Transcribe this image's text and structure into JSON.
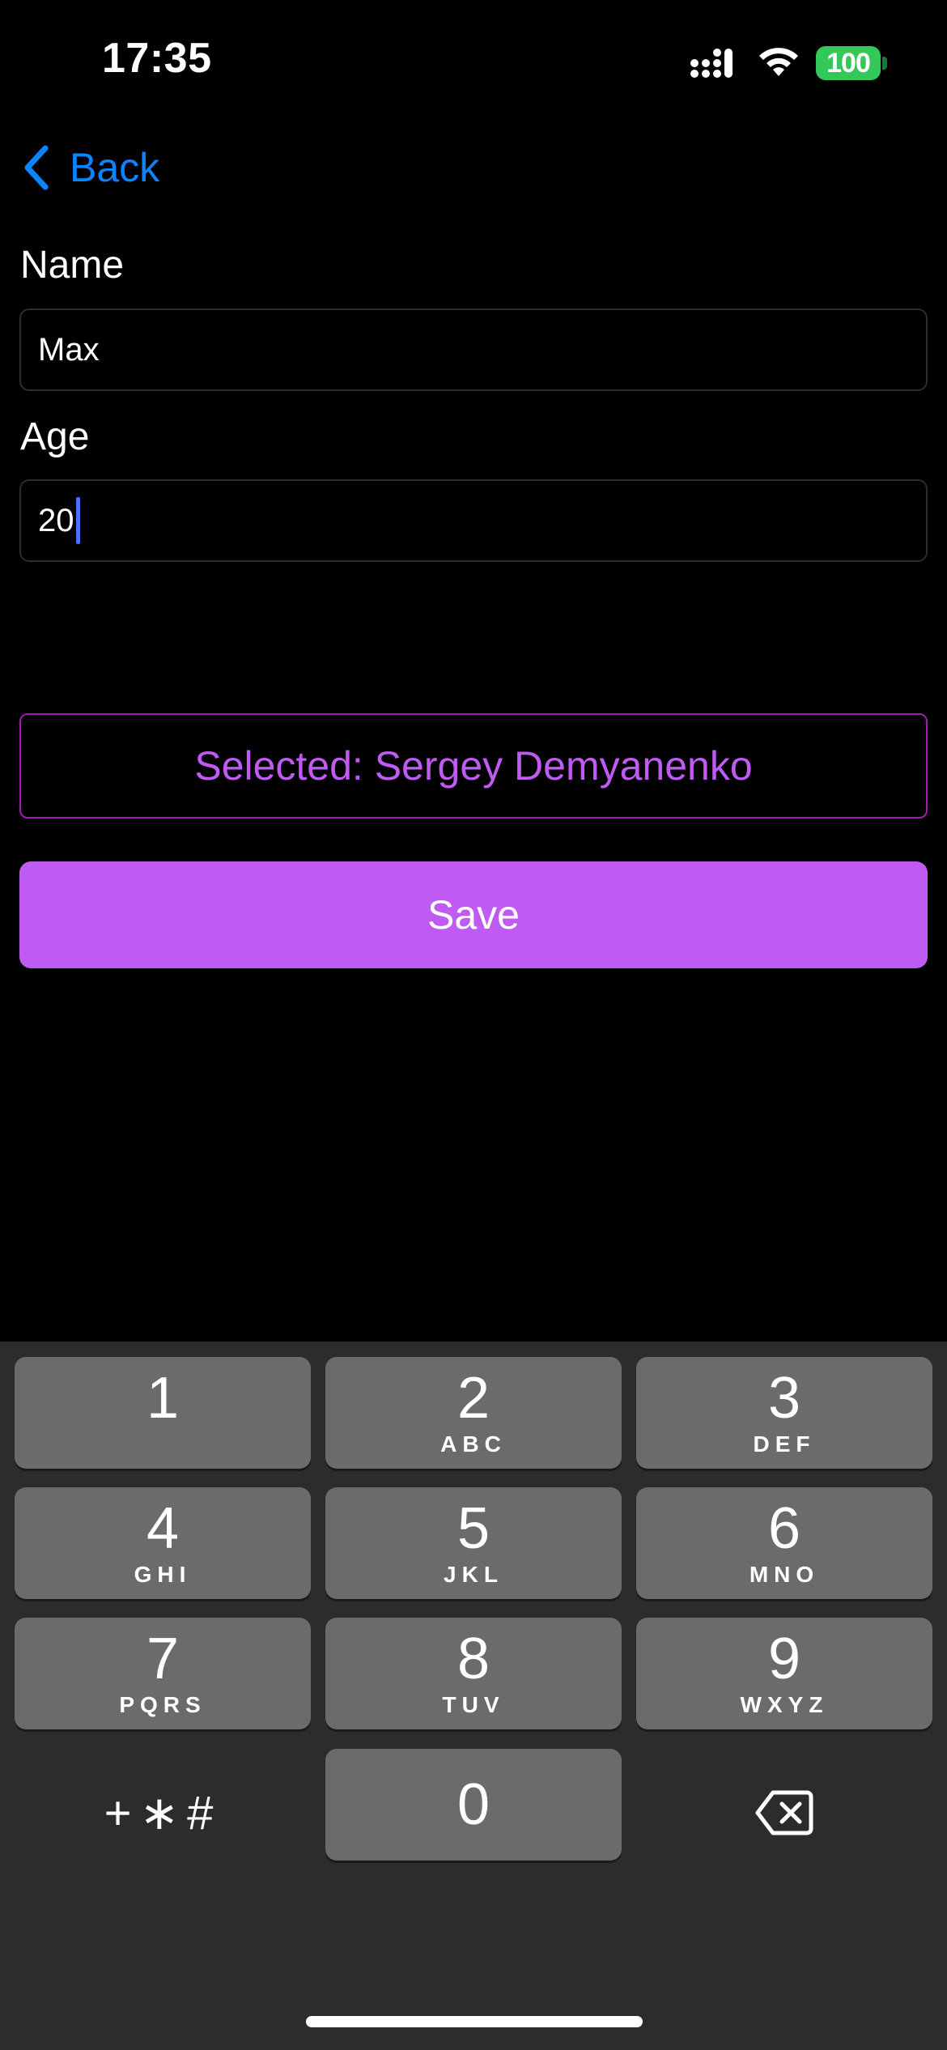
{
  "status_bar": {
    "time": "17:35",
    "battery": "100",
    "battery_color": "#34c759"
  },
  "nav": {
    "back_label": "Back",
    "accent_color": "#0a84ff"
  },
  "form": {
    "name_label": "Name",
    "name_value": "Max",
    "age_label": "Age",
    "age_value": "20"
  },
  "selected": {
    "text": "Selected: Sergey Demyanenko",
    "color": "#bf5af2"
  },
  "save_button": {
    "label": "Save",
    "color": "#bf5af2"
  },
  "keyboard": {
    "keys": [
      {
        "digit": "1",
        "letters": ""
      },
      {
        "digit": "2",
        "letters": "ABC"
      },
      {
        "digit": "3",
        "letters": "DEF"
      },
      {
        "digit": "4",
        "letters": "GHI"
      },
      {
        "digit": "5",
        "letters": "JKL"
      },
      {
        "digit": "6",
        "letters": "MNO"
      },
      {
        "digit": "7",
        "letters": "PQRS"
      },
      {
        "digit": "8",
        "letters": "TUV"
      },
      {
        "digit": "9",
        "letters": "WXYZ"
      },
      {
        "digit": "0",
        "letters": ""
      }
    ],
    "symbols_label": "+∗#",
    "delete_icon": "delete-backward-icon"
  }
}
